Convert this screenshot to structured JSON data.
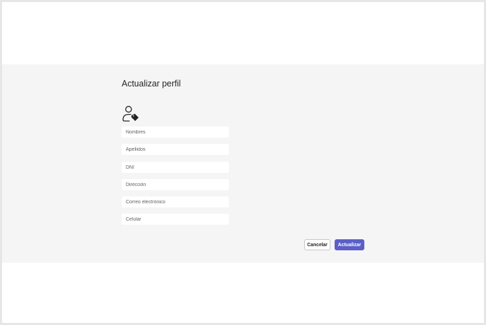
{
  "form": {
    "title": "Actualizar perfil",
    "icon": "person-tag-icon",
    "fields": [
      {
        "placeholder": "Nombres",
        "value": ""
      },
      {
        "placeholder": "Apellidos",
        "value": ""
      },
      {
        "placeholder": "DNI",
        "value": ""
      },
      {
        "placeholder": "Dirección",
        "value": ""
      },
      {
        "placeholder": "Correo electrónico",
        "value": ""
      },
      {
        "placeholder": "Celular",
        "value": ""
      }
    ]
  },
  "actions": {
    "cancel_label": "Cancelar",
    "update_label": "Actualizar"
  },
  "colors": {
    "accent": "#5b5fc7",
    "band_background": "#f5f5f5",
    "page_background": "#ffffff"
  }
}
